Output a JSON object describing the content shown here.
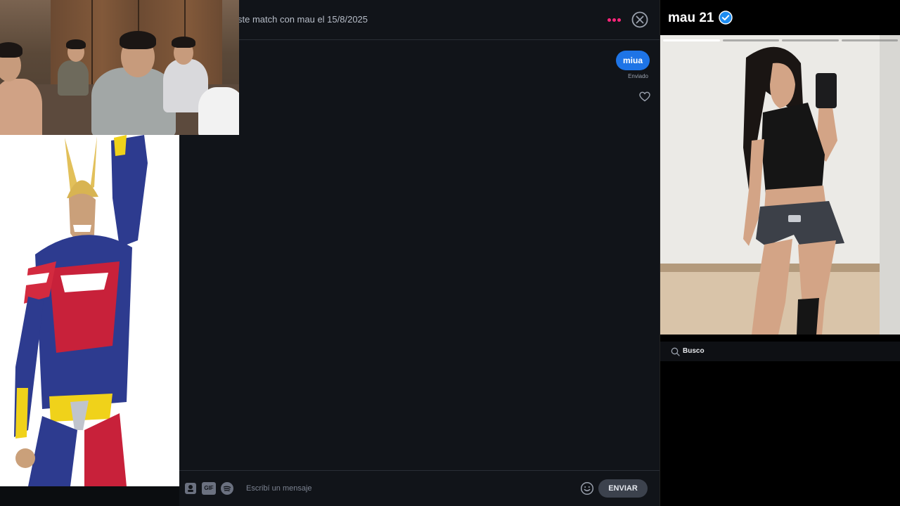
{
  "chat": {
    "match_text": "ste match con mau el 15/8/2025",
    "messages": [
      {
        "text": "miua",
        "status": "Enviado"
      }
    ],
    "composer": {
      "placeholder": "Escribí un mensaje",
      "gif_label": "GIF",
      "send_label": "ENVIAR"
    }
  },
  "profile": {
    "name_age": "mau 21",
    "photo_count": 4,
    "active_photo": 1,
    "looking_for_label": "Busco"
  },
  "colors": {
    "accent": "#fd267a",
    "bubble": "#1e74e6",
    "background": "#111419"
  },
  "icons": [
    "more-dots-icon",
    "close-circle-icon",
    "heart-icon",
    "sticker-icon",
    "gif-icon",
    "spotify-icon",
    "emoji-icon",
    "verified-badge-icon",
    "search-icon"
  ]
}
